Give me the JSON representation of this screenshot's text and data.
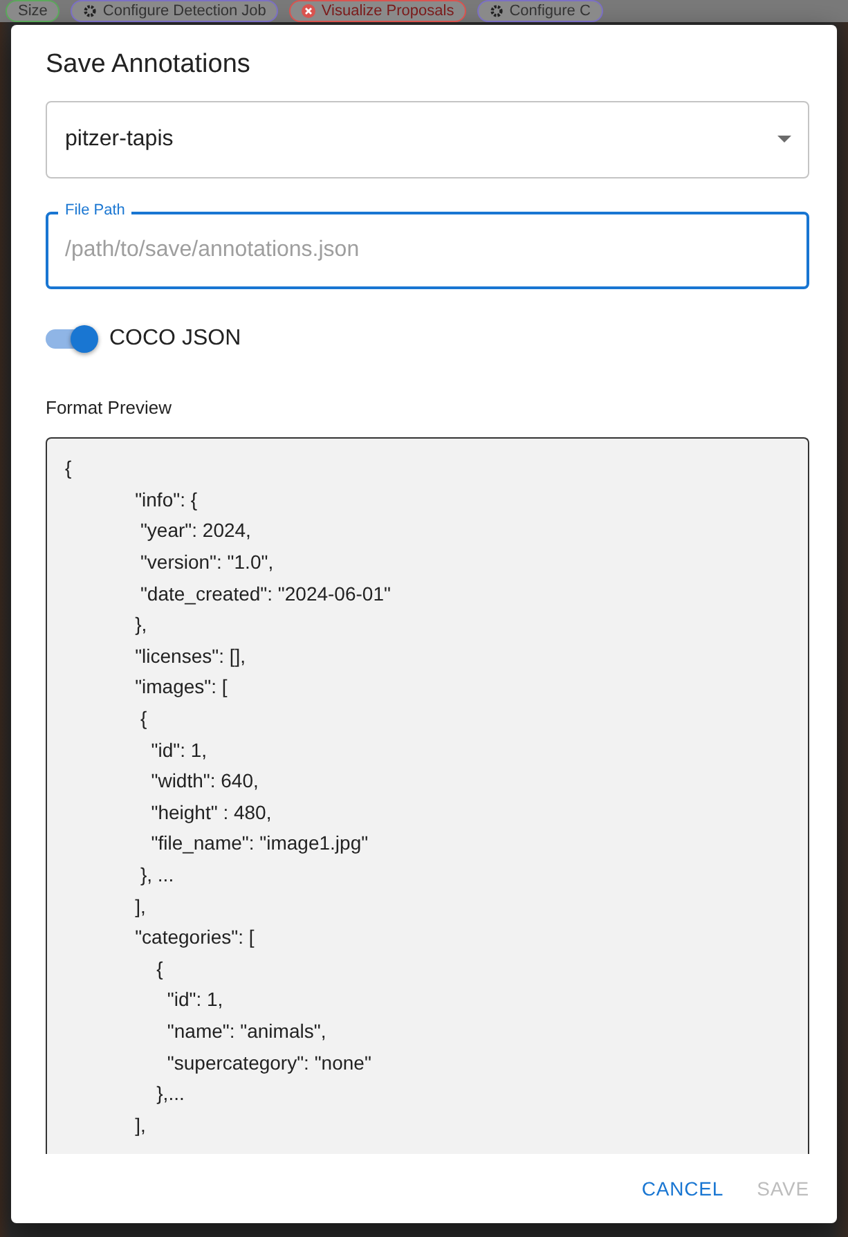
{
  "background": {
    "steps": [
      {
        "label": "Size",
        "kind": "plain",
        "color": "#5aa85a"
      },
      {
        "label": "Configure Detection Job",
        "kind": "gear",
        "color": "#7b6fc4"
      },
      {
        "label": "Visualize Proposals",
        "kind": "error",
        "color": "#d9534f"
      },
      {
        "label": "Configure C",
        "kind": "gear",
        "color": "#7b6fc4"
      }
    ]
  },
  "dialog": {
    "title": "Save Annotations",
    "select": {
      "value": "pitzer-tapis"
    },
    "file_path": {
      "label": "File Path",
      "placeholder": "/path/to/save/annotations.json"
    },
    "format_toggle": {
      "label": "COCO JSON",
      "on": true
    },
    "preview": {
      "label": "Format Preview",
      "lines": [
        "{",
        "             \"info\": {",
        "              \"year\": 2024,",
        "              \"version\": \"1.0\",",
        "              \"date_created\": \"2024-06-01\"",
        "             },",
        "             \"licenses\": [],",
        "             \"images\": [",
        "              {",
        "                \"id\": 1,",
        "                \"width\": 640,",
        "                \"height\" : 480,",
        "                \"file_name\": \"image1.jpg\"",
        "              }, ...",
        "             ],",
        "             \"categories\": [",
        "                 {",
        "                   \"id\": 1,",
        "                   \"name\": \"animals\",",
        "                   \"supercategory\": \"none\"",
        "                 },...",
        "             ],"
      ]
    },
    "buttons": [
      {
        "label": "CANCEL",
        "disabled": false
      },
      {
        "label": "SAVE",
        "disabled": true
      }
    ]
  }
}
